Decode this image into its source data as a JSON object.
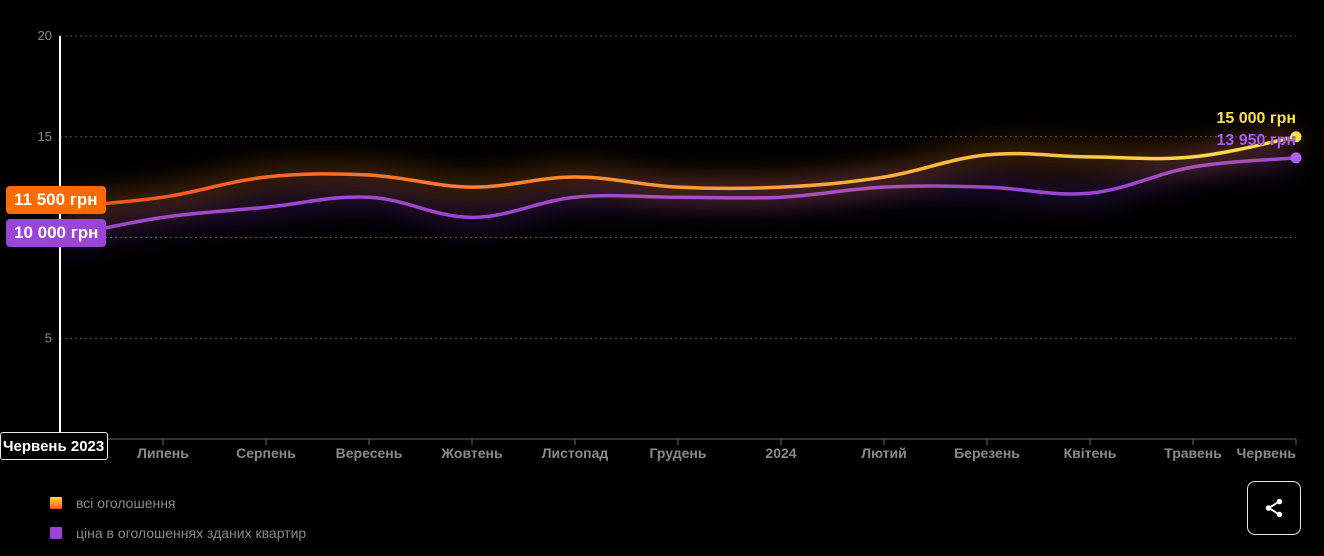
{
  "chart_data": {
    "type": "line",
    "y_ticks": [
      "5",
      "10",
      "15",
      "20"
    ],
    "ylim": [
      0,
      20
    ],
    "grid": true,
    "x_labels": [
      "Липень",
      "Серпень",
      "Вересень",
      "Жовтень",
      "Листопад",
      "Грудень",
      "2024",
      "Лютий",
      "Березень",
      "Квітень",
      "Травень",
      "Червень"
    ],
    "x": [
      "Червень 2023",
      "Липень",
      "Серпень",
      "Вересень",
      "Жовтень",
      "Листопад",
      "Грудень",
      "2024",
      "Лютий",
      "Березень",
      "Квітень",
      "Травень",
      "Червень"
    ],
    "series": [
      {
        "name": "всі оголошення",
        "color": "#ff8c1a",
        "values": [
          11.5,
          12.0,
          13.0,
          13.1,
          12.5,
          13.0,
          12.5,
          12.5,
          13.0,
          14.1,
          14.0,
          14.0,
          15.0
        ]
      },
      {
        "name": "ціна в оголошеннях зданих квартир",
        "color": "#9b45d6",
        "values": [
          10.0,
          11.0,
          11.5,
          12.0,
          11.0,
          12.0,
          12.0,
          12.0,
          12.5,
          12.5,
          12.2,
          13.5,
          13.95
        ]
      }
    ],
    "start_labels": [
      "11 500 грн",
      "10 000 грн"
    ],
    "end_labels": [
      "15 000 грн",
      "13 950 грн"
    ],
    "end_label_colors": [
      "#ffe14d",
      "#b05cff"
    ],
    "hover_date": "Червень 2023",
    "legend_position": "bottom-left"
  },
  "share_icon": "share-icon"
}
